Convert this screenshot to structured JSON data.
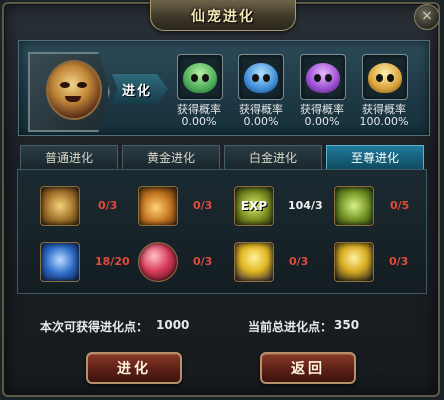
{
  "window": {
    "title": "仙宠进化",
    "close_glyph": "×"
  },
  "evolution": {
    "source_pet_icon": "mask-pet-icon",
    "arrow_label": "进化",
    "results": [
      {
        "icon": "green-pet-icon",
        "color": "#4fae5a",
        "label": "获得概率",
        "probability": "0.00%"
      },
      {
        "icon": "blue-pet-icon",
        "color": "#3f8fd8",
        "label": "获得概率",
        "probability": "0.00%"
      },
      {
        "icon": "purple-pet-icon",
        "color": "#9b4fd0",
        "label": "获得概率",
        "probability": "0.00%"
      },
      {
        "icon": "gold-pet-icon",
        "color": "#d9a33a",
        "label": "获得概率",
        "probability": "100.00%"
      }
    ]
  },
  "tabs": [
    {
      "label": "普通进化",
      "active": false
    },
    {
      "label": "黄金进化",
      "active": false
    },
    {
      "label": "白金进化",
      "active": false
    },
    {
      "label": "至尊进化",
      "active": true
    }
  ],
  "items": [
    {
      "icon": "gold-coin-icon",
      "count": "0/3",
      "count_color": "#e24a3a"
    },
    {
      "icon": "gold-scroll-icon",
      "count": "0/3",
      "count_color": "#e24a3a"
    },
    {
      "icon": "exp-icon",
      "count": "104/3",
      "count_color": "#f0f0f0",
      "text": "EXP"
    },
    {
      "icon": "green-orb-icon",
      "count": "0/5",
      "count_color": "#e24a3a"
    },
    {
      "icon": "blue-crystal-icon",
      "count": "18/20",
      "count_color": "#e24a3a"
    },
    {
      "icon": "red-orb-icon",
      "count": "0/3",
      "count_color": "#e24a3a"
    },
    {
      "icon": "yellow-arrow-icon",
      "count": "0/3",
      "count_color": "#e24a3a"
    },
    {
      "icon": "yellow-arrow-dark-icon",
      "count": "0/3",
      "count_color": "#e24a3a"
    }
  ],
  "info": {
    "gain_label": "本次可获得进化点：",
    "gain_value": "1000",
    "total_label": "当前总进化点：",
    "total_value": "350"
  },
  "buttons": {
    "evolve": "进化",
    "back": "返回"
  }
}
